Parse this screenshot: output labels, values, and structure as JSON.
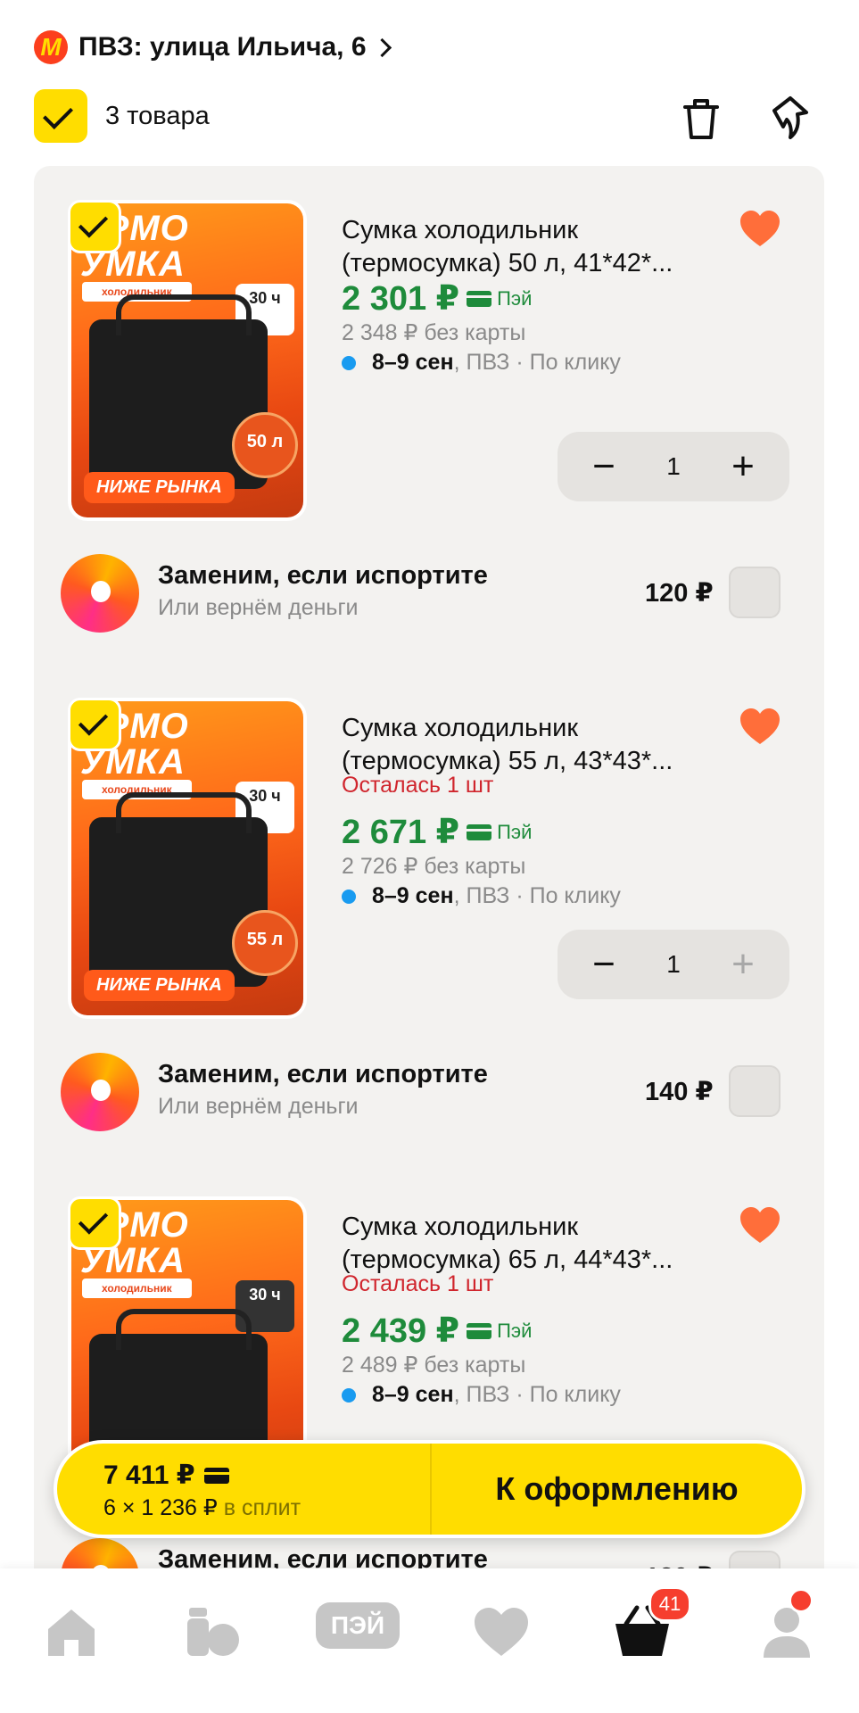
{
  "header": {
    "pvz_logo_letter": "М",
    "pvz_label": "ПВЗ: улица Ильича, 6",
    "select_all_label": "3 товара"
  },
  "items": [
    {
      "thumb_title": "ЕРМО\nУМКА",
      "thumb_sub": "холодильник",
      "thumb_hours": "30 ч",
      "thumb_volume": "50 л",
      "thumb_tag": "НИЖЕ РЫНКА",
      "title": "Сумка холодильник (термосумка) 50 л, 41*42*...",
      "stock": "",
      "price": "2 301 ₽",
      "pay": "Пэй",
      "old_price": "2 348 ₽  без карты",
      "delivery_bold": "8–9 сен",
      "delivery_rest": ", ПВЗ · По клику",
      "qty": "1",
      "minus": "−",
      "plus": "+",
      "plus_disabled": false
    },
    {
      "thumb_title": "ЕРМО\nУМКА",
      "thumb_sub": "холодильник",
      "thumb_hours": "30 ч",
      "thumb_volume": "55 л",
      "thumb_tag": "НИЖЕ РЫНКА",
      "title": "Сумка холодильник (термосумка) 55 л, 43*43*...",
      "stock": "Осталась 1 шт",
      "price": "2 671 ₽",
      "pay": "Пэй",
      "old_price": "2 726 ₽  без карты",
      "delivery_bold": "8–9 сен",
      "delivery_rest": ", ПВЗ · По клику",
      "qty": "1",
      "minus": "−",
      "plus": "+",
      "plus_disabled": true
    },
    {
      "thumb_title": "ЕРМО\nУМКА",
      "thumb_sub": "холодильник",
      "thumb_hours": "30 ч",
      "thumb_volume": "",
      "thumb_tag": "",
      "title": "Сумка холодильник (термосумка) 65 л, 44*43*...",
      "stock": "Осталась 1 шт",
      "price": "2 439 ₽",
      "pay": "Пэй",
      "old_price": "2 489 ₽  без карты",
      "delivery_bold": "8–9 сен",
      "delivery_rest": ", ПВЗ · По клику"
    }
  ],
  "insurance": [
    {
      "title": "Заменим, если испортите",
      "subtitle": "Или вернём деньги",
      "price": "120 ₽"
    },
    {
      "title": "Заменим, если испортите",
      "subtitle": "Или вернём деньги",
      "price": "140 ₽"
    },
    {
      "title": "Заменим, если испортите",
      "subtitle": "",
      "price": "130 ₽"
    }
  ],
  "checkout": {
    "total": "7 411 ₽",
    "split": "6 × 1 236 ₽",
    "split_suffix": "в сплит",
    "button": "К оформлению"
  },
  "nav": {
    "pay_label": "ПЭЙ",
    "cart_badge": "41",
    "icons": [
      "home-icon",
      "catalog-icon",
      "pay-icon",
      "favorites-icon",
      "cart-icon",
      "profile-icon"
    ]
  },
  "colors": {
    "accent_yellow": "#ffdd00",
    "price_green": "#1e8b3b",
    "stock_red": "#d0252d",
    "heart_orange": "#ff6e3a",
    "badge_red": "#f63e2e",
    "delivery_dot": "#199bf0"
  }
}
